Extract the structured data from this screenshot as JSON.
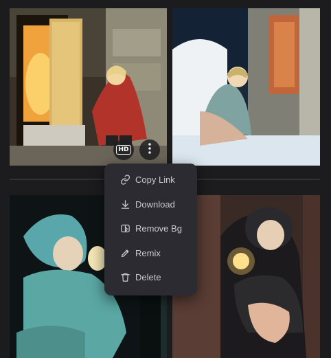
{
  "gallery": {
    "images": [
      {
        "icon": "image-icon"
      },
      {
        "icon": "image-icon"
      },
      {
        "icon": "image-icon"
      },
      {
        "icon": "image-icon"
      }
    ],
    "overlay": {
      "hd_label": "HD",
      "more_icon": "more-vertical-icon"
    }
  },
  "context_menu": {
    "items": [
      {
        "label": "Copy Link",
        "icon": "link-icon"
      },
      {
        "label": "Download",
        "icon": "download-icon"
      },
      {
        "label": "Remove Bg",
        "icon": "remove-bg-icon"
      },
      {
        "label": "Remix",
        "icon": "pencil-icon"
      },
      {
        "label": "Delete",
        "icon": "trash-icon"
      }
    ]
  },
  "colors": {
    "menu_background": "#2b2b31",
    "menu_text": "#c9c9d1",
    "page_background": "#1c1c1f"
  }
}
